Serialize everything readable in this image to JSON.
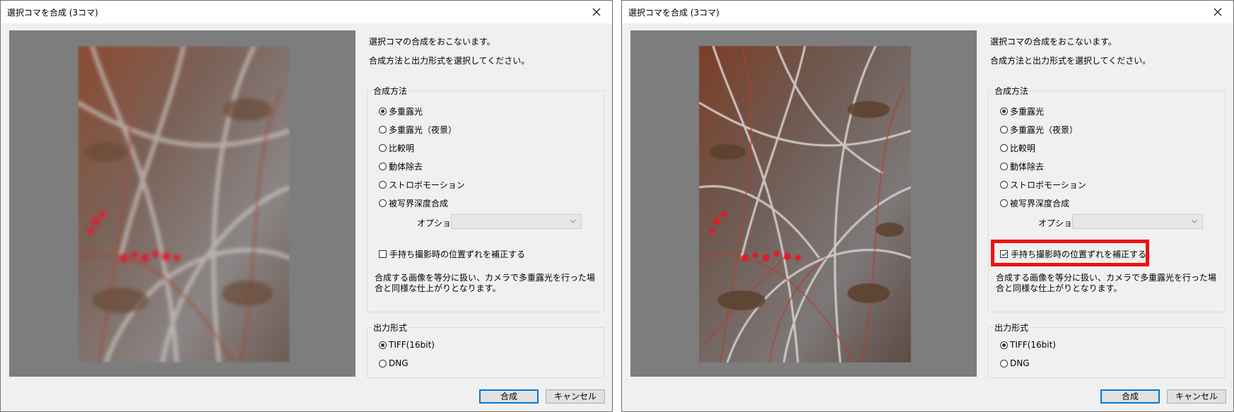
{
  "dialogs": [
    {
      "title": "選択コマを合成 (3コマ)",
      "intro_line1": "選択コマの合成をおこないます。",
      "intro_line2": "合成方法と出力形式を選択してください。",
      "method_group": {
        "legend": "合成方法",
        "options": [
          "多重露光",
          "多重露光（夜景）",
          "比較明",
          "動体除去",
          "ストロボモーション",
          "被写界深度合成"
        ],
        "selected": "多重露光"
      },
      "option_label": "オプション",
      "option_value": "",
      "hand_check": {
        "label": "手持ち撮影時の位置ずれを補正する",
        "checked": false
      },
      "description": "合成する画像を等分に扱い、カメラで多重露光を行った場合と同様な仕上がりとなります。",
      "output_group": {
        "legend": "出力形式",
        "options": [
          "TIFF(16bit)",
          "DNG"
        ],
        "selected": "TIFF(16bit)"
      },
      "buttons": {
        "ok": "合成",
        "cancel": "キャンセル"
      }
    },
    {
      "title": "選択コマを合成 (3コマ)",
      "intro_line1": "選択コマの合成をおこないます。",
      "intro_line2": "合成方法と出力形式を選択してください。",
      "method_group": {
        "legend": "合成方法",
        "options": [
          "多重露光",
          "多重露光（夜景）",
          "比較明",
          "動体除去",
          "ストロボモーション",
          "被写界深度合成"
        ],
        "selected": "多重露光"
      },
      "option_label": "オプション",
      "option_value": "",
      "hand_check": {
        "label": "手持ち撮影時の位置ずれを補正する",
        "checked": true
      },
      "description": "合成する画像を等分に扱い、カメラで多重露光を行った場合と同様な仕上がりとなります。",
      "output_group": {
        "legend": "出力形式",
        "options": [
          "TIFF(16bit)",
          "DNG"
        ],
        "selected": "TIFF(16bit)"
      },
      "buttons": {
        "ok": "合成",
        "cancel": "キャンセル"
      }
    }
  ],
  "colors": {
    "dialog_bg": "#f0f0f0",
    "preview_bg": "#7d7d7d",
    "highlight": "#ee1010",
    "primary_border": "#0078d7"
  },
  "icons": {
    "close": "close-icon",
    "dropdown": "chevron-down-icon"
  }
}
